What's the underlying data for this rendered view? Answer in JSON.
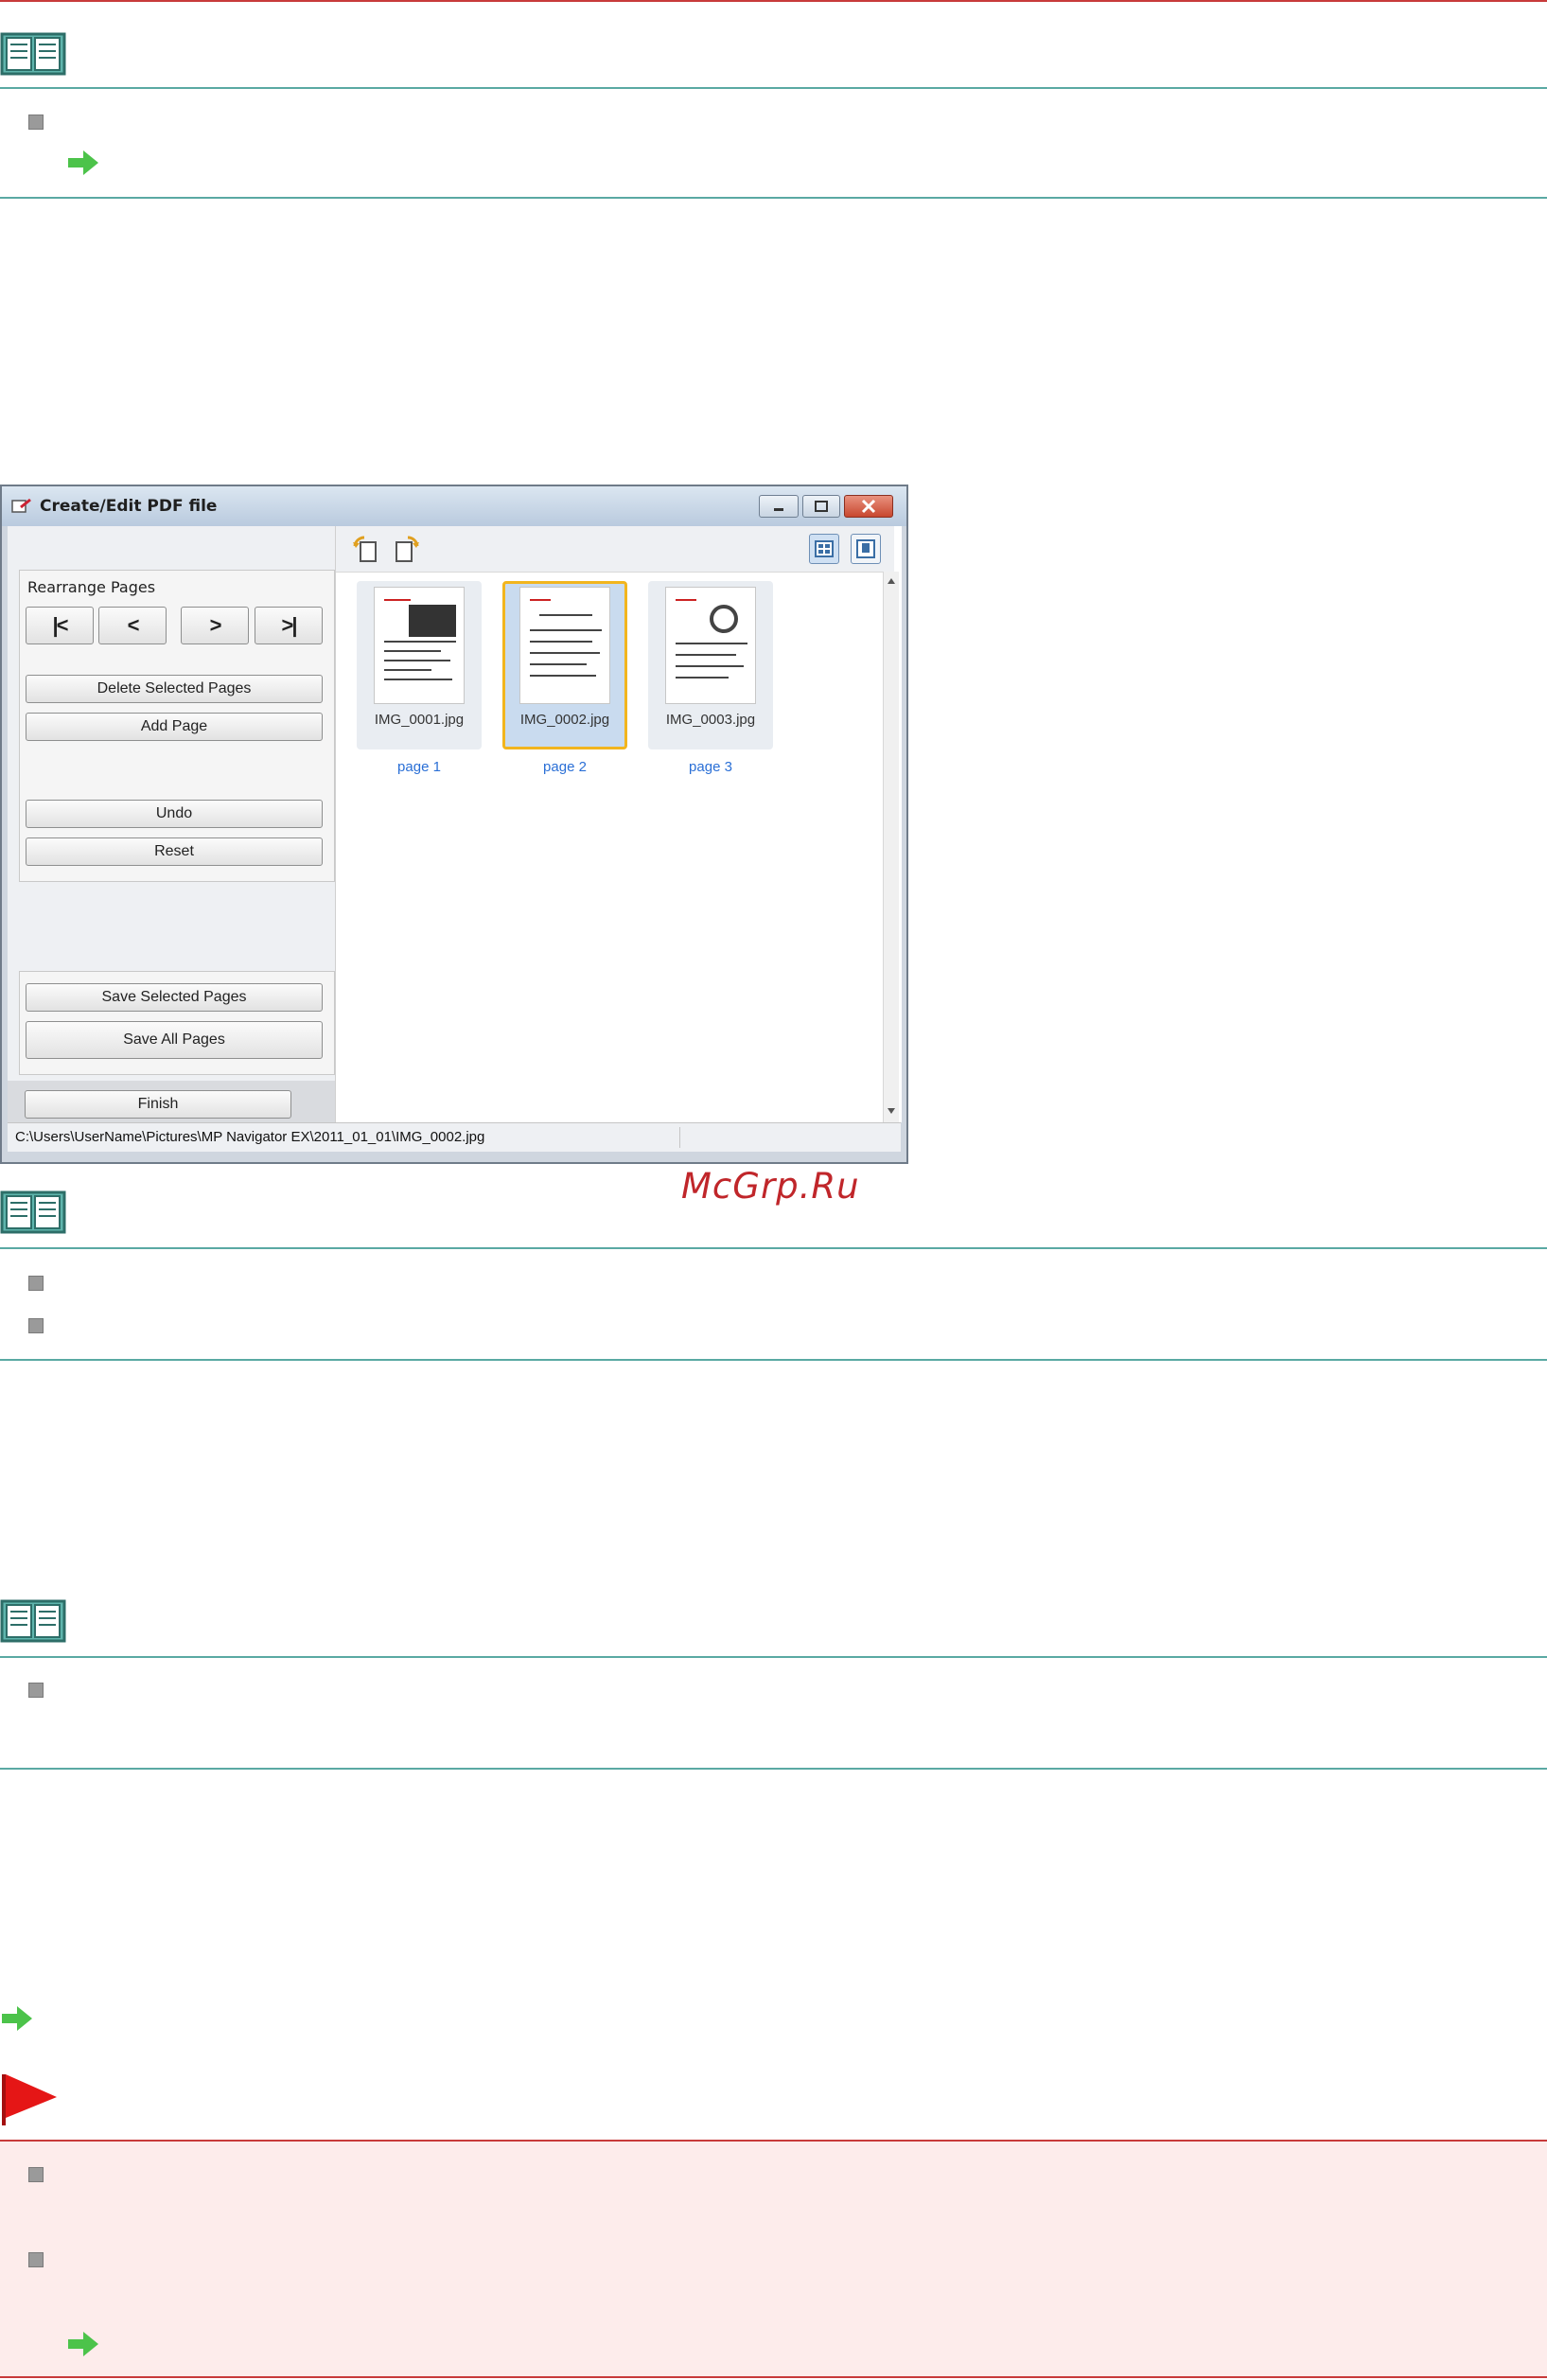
{
  "window": {
    "title": "Create/Edit PDF file",
    "rearrange_label": "Rearrange Pages",
    "nav_first": "|<",
    "nav_prev": "<",
    "nav_next": ">",
    "nav_last": ">|",
    "delete_selected": "Delete Selected Pages",
    "add_page": "Add Page",
    "undo": "Undo",
    "reset": "Reset",
    "save_selected": "Save Selected Pages",
    "save_all": "Save All Pages",
    "finish": "Finish",
    "thumbnails": [
      {
        "name": "IMG_0001.jpg",
        "page": "page 1"
      },
      {
        "name": "IMG_0002.jpg",
        "page": "page 2"
      },
      {
        "name": "IMG_0003.jpg",
        "page": "page 3"
      }
    ],
    "status_path": "C:\\Users\\UserName\\Pictures\\MP Navigator EX\\2011_01_01\\IMG_0002.jpg"
  },
  "watermark": "McGrp.Ru",
  "colors": {
    "note_rule": "#5aa9a3",
    "important_rule": "#c83a3a",
    "important_bg": "#fdeceb",
    "selection_border": "#f2b51e",
    "page_label": "#2a6fd6"
  },
  "icons": [
    "note-book-icon",
    "green-arrow-icon",
    "gray-bullet-icon",
    "red-flag-icon"
  ]
}
